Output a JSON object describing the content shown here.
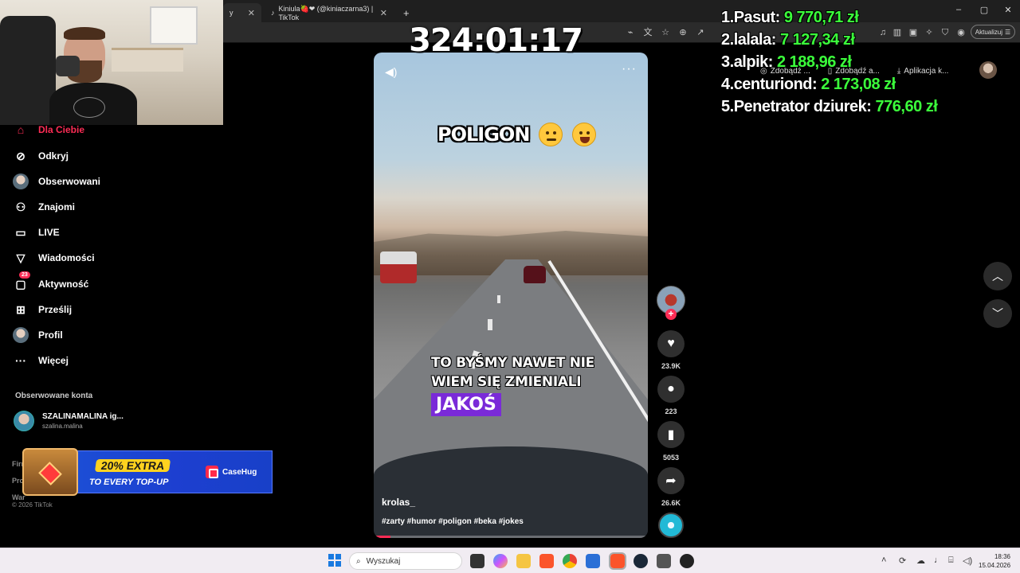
{
  "browser": {
    "tabs": [
      {
        "label": "y",
        "active": true
      },
      {
        "label": "Kiniula🍓❤ (@kiniaczarna3) | TikTok",
        "active": false
      }
    ],
    "new_tab": "+",
    "update_label": "Aktualizuj",
    "window_controls": [
      "–",
      "▢",
      "✕"
    ]
  },
  "overlay": {
    "timer": "324:01:17",
    "leaderboard": [
      {
        "rank": "1.",
        "name": "Pasut:",
        "amount": "9 770,71 zł"
      },
      {
        "rank": "2.",
        "name": "lalala:",
        "amount": "7 127,34 zł"
      },
      {
        "rank": "3.",
        "name": "alpik:",
        "amount": "2 188,96 zł"
      },
      {
        "rank": "4.",
        "name": "centuriond:",
        "amount": "2 173,08 zł"
      },
      {
        "rank": "5.",
        "name": "Penetrator dziurek:",
        "amount": "776,60 zł"
      }
    ]
  },
  "tiktok_top": {
    "get_coins_1": "Zdobądź ...",
    "get_coins_2": "Zdobądź a...",
    "app_download": "Aplikacja k..."
  },
  "sidebar": {
    "items": [
      {
        "label": "Dla Ciebie",
        "icon": "home-icon",
        "active": true
      },
      {
        "label": "Odkryj",
        "icon": "compass-icon"
      },
      {
        "label": "Obserwowani",
        "icon": "avatar-icon"
      },
      {
        "label": "Znajomi",
        "icon": "friends-icon"
      },
      {
        "label": "LIVE",
        "icon": "live-tv-icon"
      },
      {
        "label": "Wiadomości",
        "icon": "send-icon"
      },
      {
        "label": "Aktywność",
        "icon": "message-icon",
        "badge": "23"
      },
      {
        "label": "Prześlij",
        "icon": "plus-square-icon"
      },
      {
        "label": "Profil",
        "icon": "profile-avatar-icon"
      },
      {
        "label": "Więcej",
        "icon": "more-dots-icon"
      }
    ],
    "following_title": "Obserwowane konta",
    "following": {
      "name": "SZALINAMALINA ig...",
      "username": "szalina.malina"
    },
    "footer": [
      "Firm",
      "Pro",
      "War"
    ],
    "copyright": "© 2026 TikTok"
  },
  "ad": {
    "line1": "20% EXTRA",
    "line2": "TO EVERY TOP-UP",
    "brand": "CaseHug"
  },
  "video": {
    "title": "POLIGON",
    "caption_line1": "TO BYŚMY NAWET NIE",
    "caption_line2": "WIEM SIĘ ZMIENIALI",
    "caption_highlight": "JAKOŚ",
    "author": "krolas_",
    "hashtags": "#zarty #humor #poligon #beka #jokes",
    "progress": 0.06
  },
  "actions": {
    "likes": "23.9K",
    "comments": "223",
    "saves": "5053",
    "shares": "26.6K"
  },
  "taskbar": {
    "search_placeholder": "Wyszukaj",
    "time": "18:36",
    "date": "15.04.2026"
  }
}
